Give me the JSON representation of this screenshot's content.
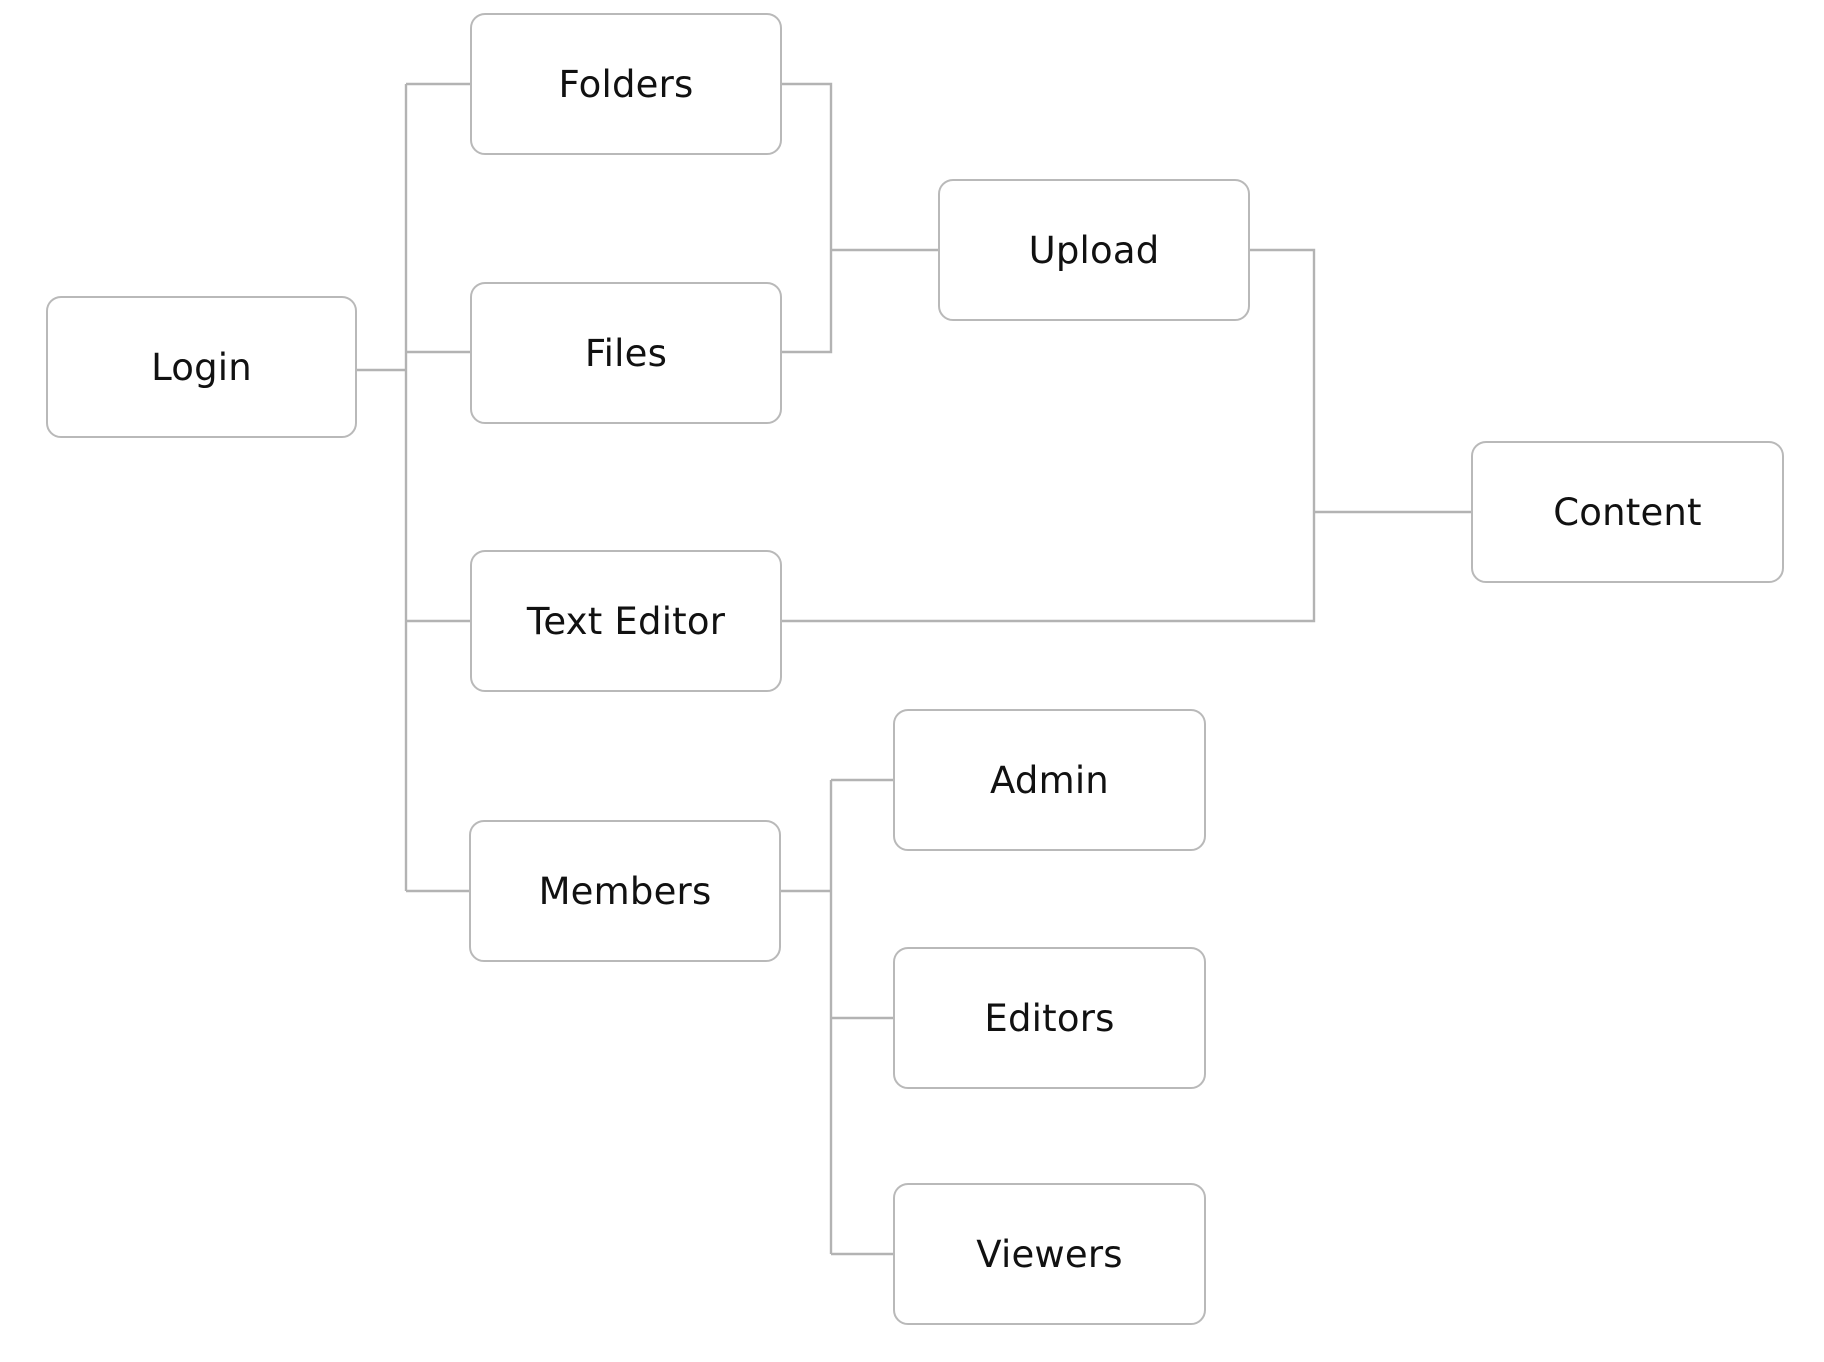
{
  "diagram": {
    "nodes": {
      "login": "Login",
      "folders": "Folders",
      "files": "Files",
      "text_editor": "Text Editor",
      "members": "Members",
      "upload": "Upload",
      "content": "Content",
      "admin": "Admin",
      "editors": "Editors",
      "viewers": "Viewers"
    },
    "edges": [
      [
        "login",
        "folders"
      ],
      [
        "login",
        "files"
      ],
      [
        "login",
        "text_editor"
      ],
      [
        "login",
        "members"
      ],
      [
        "folders",
        "upload"
      ],
      [
        "files",
        "upload"
      ],
      [
        "upload",
        "content"
      ],
      [
        "text_editor",
        "content"
      ],
      [
        "members",
        "admin"
      ],
      [
        "members",
        "editors"
      ],
      [
        "members",
        "viewers"
      ]
    ],
    "colors": {
      "line": "#b3b3b3",
      "box_border": "#b9b9b9",
      "text": "#111111",
      "background": "#ffffff"
    }
  }
}
